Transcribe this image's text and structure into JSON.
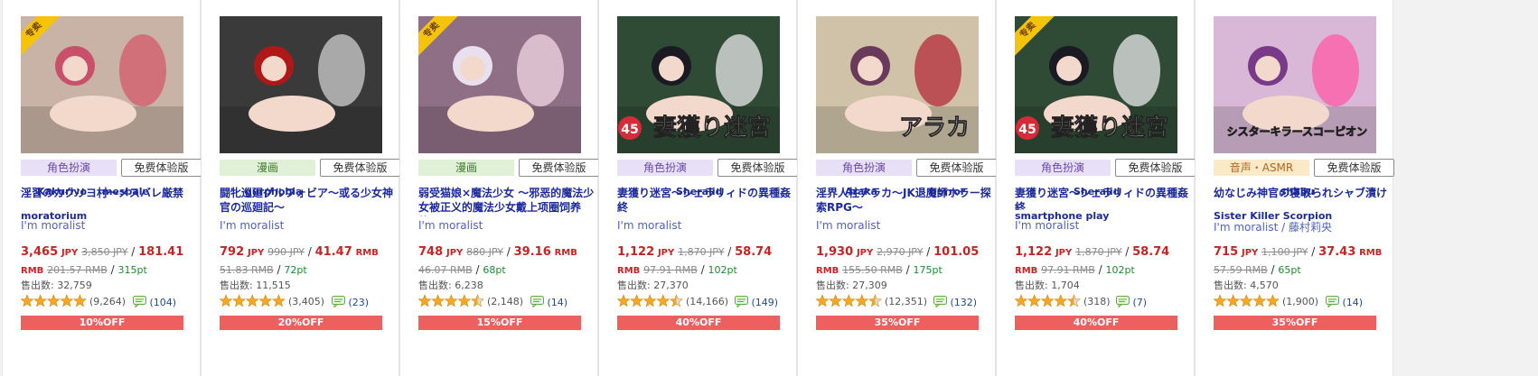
{
  "products": [
    {
      "ribbon": "专卖",
      "genre": "角色扮演",
      "genre_bg": "#e8e0f6",
      "genre_color": "#6b4aa8",
      "trial_label": "免费体验版",
      "title": "淫習のカクリヨ村～メスバレ厳禁",
      "title_overlay": "moratorium",
      "tags": [
        "Kakuriyo",
        "mesbale"
      ],
      "circle": "I'm moralist",
      "circle_extra": "",
      "price_jpy": "3,465",
      "orig_jpy": "3,850 JPY",
      "price_rmb": "181.41",
      "orig_rmb": "201.57 RMB",
      "points": "315pt",
      "sold": "售出数: 32,759",
      "rating_count": "(9,264)",
      "stars": 5,
      "comments": "(104)",
      "discount": "10%OFF",
      "art": {
        "bg": "#c9b3a6",
        "accent": "#d45a6a",
        "hair": "#c8506a"
      }
    },
    {
      "ribbon": "",
      "genre": "漫画",
      "genre_bg": "#e1f1d8",
      "genre_color": "#3f7a2e",
      "trial_label": "免费体验版",
      "title": "闘牝巡廻グルフォビア～或る少女神官の巡廻記～",
      "title_overlay": "",
      "tags": [
        "gurphobia"
      ],
      "circle": "I'm moralist",
      "circle_extra": "",
      "price_jpy": "792",
      "orig_jpy": "990 JPY",
      "price_rmb": "41.47",
      "orig_rmb": "51.83 RMB",
      "points": "72pt",
      "sold": "售出数: 11,515",
      "rating_count": "(3,405)",
      "stars": 5,
      "comments": "(23)",
      "discount": "20%OFF",
      "art": {
        "bg": "#3a3a3a",
        "accent": "#cfcfcf",
        "hair": "#b01818"
      }
    },
    {
      "ribbon": "专卖",
      "genre": "漫画",
      "genre_bg": "#e1f1d8",
      "genre_color": "#3f7a2e",
      "trial_label": "免费体验版",
      "title": "弱受猫娘×魔法少女 ～邪恶的魔法少女被正义的魔法少女戴上项圈饲养的...",
      "title_overlay": "",
      "tags": [],
      "circle": "I'm moralist",
      "circle_extra": "",
      "price_jpy": "748",
      "orig_jpy": "880 JPY",
      "price_rmb": "39.16",
      "orig_rmb": "46.07 RMB",
      "points": "68pt",
      "sold": "售出数: 6,238",
      "rating_count": "(2,148)",
      "stars": 4.5,
      "comments": "(14)",
      "discount": "15%OFF",
      "art": {
        "bg": "#8f6f86",
        "accent": "#f2d7e4",
        "hair": "#e8e0ef"
      }
    },
    {
      "ribbon": "",
      "genre": "角色扮演",
      "genre_bg": "#e8e0f6",
      "genre_color": "#6b4aa8",
      "trial_label": "免费体验版",
      "title": "妻獲り迷宮～シェラリィドの異種姦終",
      "title_overlay": "",
      "tags": [
        "Sheralid"
      ],
      "circle": "I'm moralist",
      "circle_extra": "",
      "price_jpy": "1,122",
      "orig_jpy": "1,870 JPY",
      "price_rmb": "58.74",
      "orig_rmb": "97.91 RMB",
      "points": "102pt",
      "sold": "售出数: 27,370",
      "rating_count": "(14,166)",
      "stars": 4.5,
      "comments": "(149)",
      "discount": "40%OFF",
      "art": {
        "bg": "#2f4a35",
        "accent": "#e9e9e9",
        "hair": "#1a1a22",
        "logo": "妻獲り迷宮",
        "badge": "45"
      }
    },
    {
      "ribbon": "",
      "genre": "角色扮演",
      "genre_bg": "#e8e0f6",
      "genre_color": "#6b4aa8",
      "trial_label": "免费体验版",
      "title": "淫界人柱アラカ～JK退魔師ホラー探索RPG～",
      "title_overlay": "",
      "tags": [
        "Araka",
        "horror"
      ],
      "circle": "I'm moralist",
      "circle_extra": "",
      "price_jpy": "1,930",
      "orig_jpy": "2,970 JPY",
      "price_rmb": "101.05",
      "orig_rmb": "155.50 RMB",
      "points": "175pt",
      "sold": "售出数: 27,309",
      "rating_count": "(12,351)",
      "stars": 4.5,
      "comments": "(132)",
      "discount": "35%OFF",
      "art": {
        "bg": "#cfc2a8",
        "accent": "#b42a3a",
        "hair": "#6a3a5a",
        "logo": "アラカ"
      }
    },
    {
      "ribbon": "专卖",
      "genre": "角色扮演",
      "genre_bg": "#e8e0f6",
      "genre_color": "#6b4aa8",
      "trial_label": "免费体验版",
      "title": "妻獲り迷宮～シェラリィドの異種姦終",
      "title_overlay": "smartphone play",
      "tags": [
        "Sheralid"
      ],
      "circle": "I'm moralist",
      "circle_extra": "",
      "price_jpy": "1,122",
      "orig_jpy": "1,870 JPY",
      "price_rmb": "58.74",
      "orig_rmb": "97.91 RMB",
      "points": "102pt",
      "sold": "售出数: 1,704",
      "rating_count": "(318)",
      "stars": 4.5,
      "comments": "(7)",
      "discount": "40%OFF",
      "art": {
        "bg": "#2f4a35",
        "accent": "#e9e9e9",
        "hair": "#1a1a22",
        "logo": "妻獲り迷宮",
        "badge": "45"
      }
    },
    {
      "ribbon": "",
      "genre": "音声・ASMR",
      "genre_bg": "#fbe9c8",
      "genre_color": "#b4661e",
      "trial_label": "免费体验版",
      "title": "幼なじみ神官の寝取られシャブ漬け",
      "title_overlay": "Sister Killer Scorpion",
      "tags": [
        "shabu"
      ],
      "circle": "I'm moralist",
      "circle_extra": " / 藤村莉央",
      "price_jpy": "715",
      "orig_jpy": "1,100 JPY",
      "price_rmb": "37.43",
      "orig_rmb": "57.59 RMB",
      "points": "65pt",
      "sold": "售出数: 4,570",
      "rating_count": "(1,900)",
      "stars": 5,
      "comments": "(14)",
      "discount": "35%OFF",
      "art": {
        "bg": "#d8b8d6",
        "accent": "#ff5aa6",
        "hair": "#7a3a8a",
        "logo": "シスターキラースコーピオン"
      }
    }
  ],
  "labels": {
    "jpy": "JPY",
    "rmb": "RMB"
  },
  "colors": {
    "price": "#c82323",
    "discount": "#ee5f60",
    "star": "#f5a623"
  }
}
